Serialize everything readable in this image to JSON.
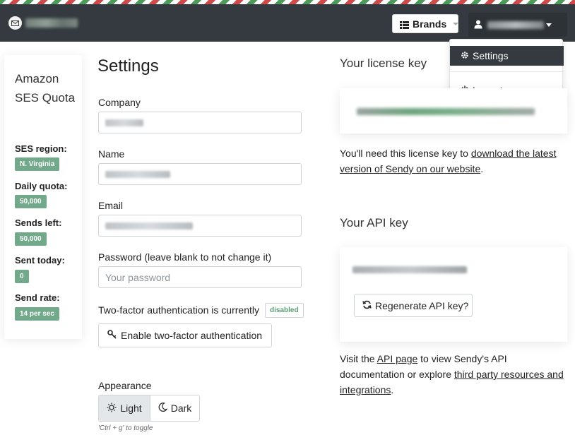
{
  "navbar": {
    "logo_icon": "envelope-icon",
    "brands_label": "Brands",
    "brands_icon": "list-icon",
    "user_icon": "user-icon"
  },
  "dropdown": {
    "settings_label": "Settings",
    "settings_icon": "gear-icon",
    "logout_label": "Logout",
    "logout_icon": "power-icon"
  },
  "quota": {
    "title": "Amazon SES Quota",
    "items": [
      {
        "label": "SES region:",
        "value": "N. Virginia"
      },
      {
        "label": "Daily quota:",
        "value": "50,000"
      },
      {
        "label": "Sends left:",
        "value": "50,000"
      },
      {
        "label": "Sent today:",
        "value": "0"
      },
      {
        "label": "Send rate:",
        "value": "14 per sec"
      }
    ],
    "badge_color": "#72a98a"
  },
  "settings": {
    "title": "Settings",
    "company_label": "Company",
    "name_label": "Name",
    "email_label": "Email",
    "password_label": "Password (leave blank to not change it)",
    "password_placeholder": "Your password",
    "tfa_text": "Two-factor authentication is currently",
    "tfa_status": "disabled",
    "tfa_button": "Enable two-factor authentication",
    "tfa_icon": "key-icon",
    "appearance_label": "Appearance",
    "light_label": "Light",
    "dark_label": "Dark",
    "toggle_hint": "'Ctrl + g' to toggle"
  },
  "license": {
    "title": "Your license key",
    "text_before": "You'll need this license key to ",
    "link_text": "download the latest version of Sendy on our website",
    "text_after": "."
  },
  "api": {
    "title": "Your API key",
    "regenerate_label": "Regenerate API key?",
    "regenerate_icon": "refresh-icon",
    "text_1": "Visit the ",
    "link_1": "API page",
    "text_2": " to view Sendy's API documentation or explore ",
    "link_2": "third party resources and integrations",
    "text_3": "."
  },
  "colors": {
    "navbar": "#343a3f",
    "accent_green": "#72a98a",
    "disabled_badge_text": "#5a9b76"
  }
}
